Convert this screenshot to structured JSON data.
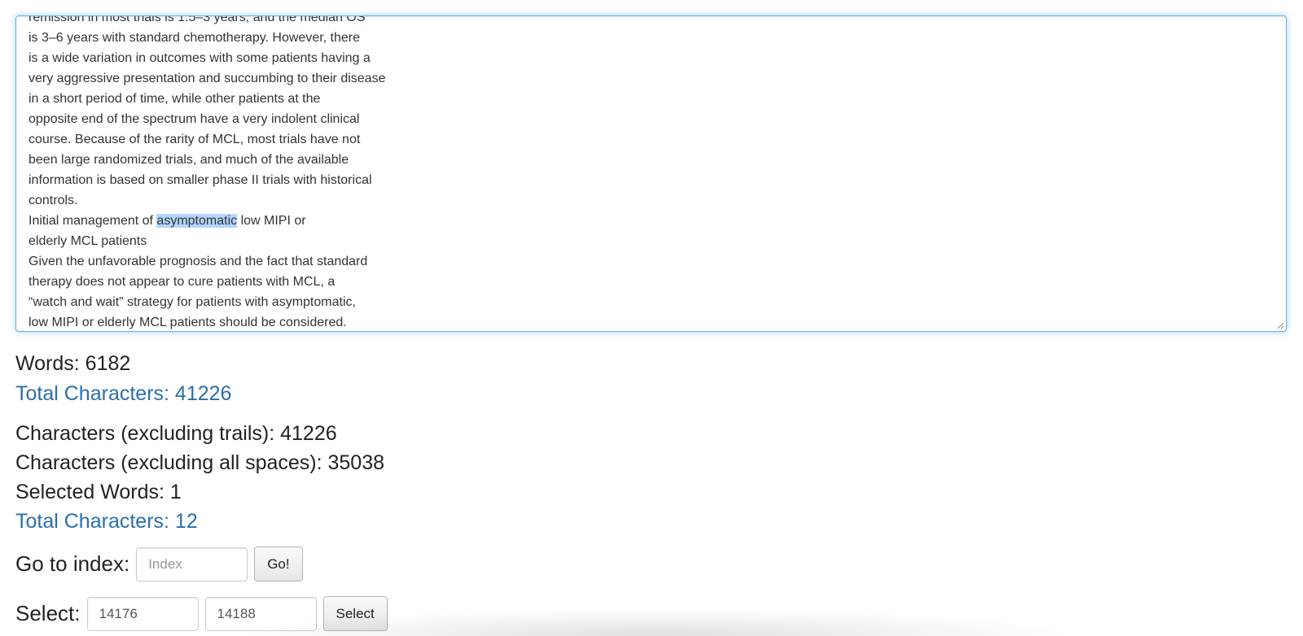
{
  "editor": {
    "lines": [
      {
        "text": "remission in most trials is 1.5–3 years, and the median OS"
      },
      {
        "text": "is 3–6 years with standard chemotherapy. However, there"
      },
      {
        "text": "is a wide variation in outcomes with some patients having a"
      },
      {
        "text": "very aggressive presentation and succumbing to their disease"
      },
      {
        "text": "in a short period of time, while other patients at the"
      },
      {
        "text": "opposite end of the spectrum have a very indolent clinical"
      },
      {
        "text": "course. Because of the rarity of MCL, most trials have not"
      },
      {
        "text": "been large randomized trials, and much of the available"
      },
      {
        "text": "information is based on smaller phase II trials with historical"
      },
      {
        "text": "controls."
      },
      {
        "before": "Initial management of ",
        "selected": "asymptomatic",
        "after": " low MIPI or"
      },
      {
        "text": "elderly MCL patients"
      },
      {
        "text": "Given the unfavorable prognosis and the fact that standard"
      },
      {
        "text": "therapy does not appear to cure patients with MCL, a"
      },
      {
        "text": "“watch and wait” strategy for patients with asymptomatic,"
      },
      {
        "text": "low MIPI or elderly MCL patients should be considered."
      }
    ],
    "selection_color": "#b4d5fe",
    "focus_color": "#66afe9"
  },
  "stats": {
    "words": "Words: 6182",
    "total_characters": "Total Characters: 41226",
    "chars_excluding_trails": "Characters (excluding trails): 41226",
    "chars_excluding_spaces": "Characters (excluding all spaces): 35038",
    "selected_words": "Selected Words: 1",
    "selected_total_characters": "Total Characters: 12",
    "link_color": "#2a6fa9"
  },
  "goto": {
    "label": "Go to index:",
    "placeholder": "Index",
    "button_label": "Go!"
  },
  "select": {
    "label": "Select:",
    "start_value": "14176",
    "end_value": "14188",
    "button_label": "Select"
  }
}
